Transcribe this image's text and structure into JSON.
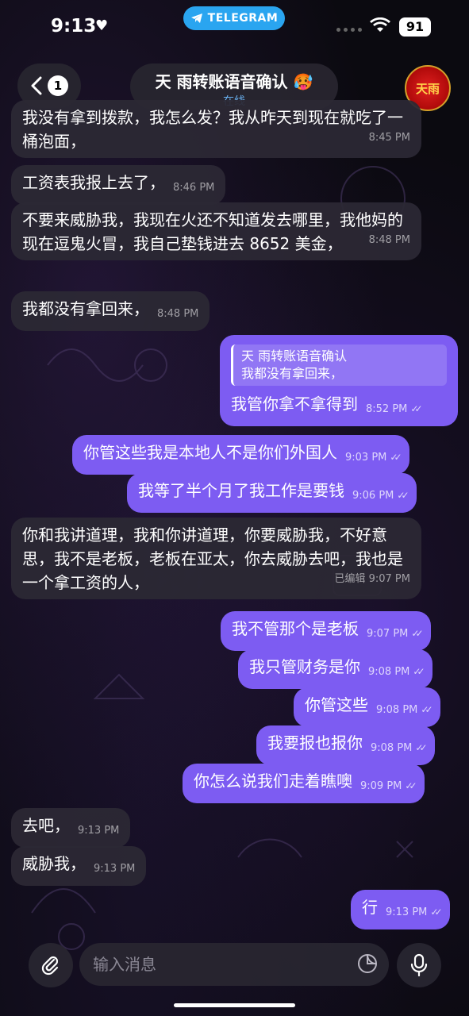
{
  "status_bar": {
    "time": "9:13",
    "telegram_label": "TELEGRAM",
    "battery": "91"
  },
  "header": {
    "back_badge": "1",
    "title": "天 雨转账语音确认 🥵",
    "status": "在线",
    "avatar_text": "天雨"
  },
  "messages": [
    {
      "dir": "in",
      "text": "我没有拿到拨款，我怎么发？我从昨天到现在就吃了一桶泡面，",
      "time": "8:45 PM"
    },
    {
      "dir": "in",
      "text": "工资表我报上去了，",
      "time": "8:46 PM"
    },
    {
      "dir": "in",
      "text": "不要来威胁我，我现在火还不知道发去哪里，我他妈的现在逗鬼火冒，我自己垫钱进去 8652 美金，",
      "time": "8:48 PM"
    },
    {
      "dir": "in",
      "text": "我都没有拿回来，",
      "time": "8:48 PM"
    },
    {
      "dir": "out",
      "reply_author": "天 雨转账语音确认",
      "reply_text": "我都没有拿回来，",
      "text": "我管你拿不拿得到",
      "time": "8:52 PM"
    },
    {
      "dir": "out",
      "text": "你管这些我是本地人不是你们外国人",
      "time": "9:03 PM"
    },
    {
      "dir": "out",
      "text": "我等了半个月了我工作是要钱",
      "time": "9:06 PM"
    },
    {
      "dir": "in",
      "text": "你和我讲道理，我和你讲道理，你要威胁我，不好意思，我不是老板，老板在亚太，你去威胁去吧，我也是一个拿工资的人，",
      "edited": "已编辑",
      "time": "9:07 PM"
    },
    {
      "dir": "out",
      "text": "我不管那个是老板",
      "time": "9:07 PM"
    },
    {
      "dir": "out",
      "text": "我只管财务是你",
      "time": "9:08 PM"
    },
    {
      "dir": "out",
      "text": "你管这些",
      "time": "9:08 PM"
    },
    {
      "dir": "out",
      "text": "我要报也报你",
      "time": "9:08 PM"
    },
    {
      "dir": "out",
      "text": "你怎么说我们走着瞧噢",
      "time": "9:09 PM"
    },
    {
      "dir": "in",
      "text": "去吧，",
      "time": "9:13 PM"
    },
    {
      "dir": "in",
      "text": "威胁我，",
      "time": "9:13 PM"
    },
    {
      "dir": "out",
      "text": "行",
      "time": "9:13 PM"
    }
  ],
  "input": {
    "placeholder": "输入消息"
  },
  "icons": {
    "back": "chevron-left-icon",
    "attach": "paperclip-icon",
    "sticker": "sticker-icon",
    "mic": "microphone-icon",
    "read": "double-check-icon"
  },
  "colors": {
    "outgoing_bubble": "#7d5cf2",
    "incoming_bubble": "#2c2834",
    "telegram_pill": "#2aa5f0",
    "online_status": "#6ab3f3"
  }
}
